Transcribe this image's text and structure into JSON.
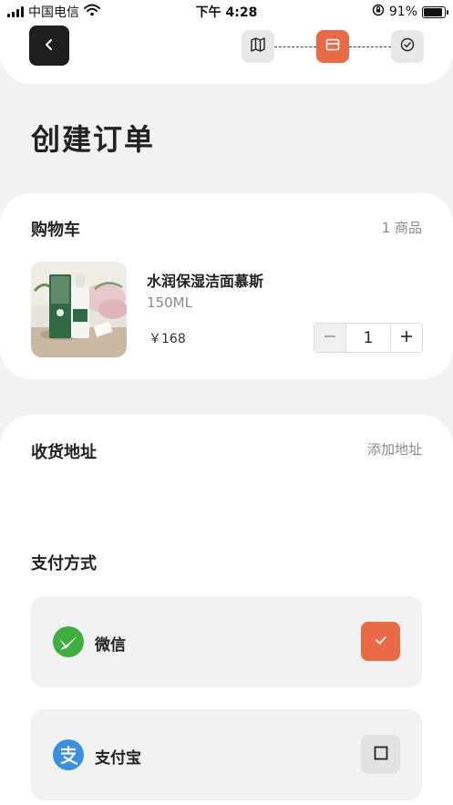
{
  "status_bar": {
    "carrier": "中国电信",
    "time": "下午 4:28",
    "battery": "91%",
    "battery_level": 0.91
  },
  "header": {
    "back_icon": "chevron-left-icon",
    "steps": [
      {
        "icon": "map-icon",
        "state": "done"
      },
      {
        "icon": "card-icon",
        "state": "active"
      },
      {
        "icon": "check-circle-icon",
        "state": "pending"
      }
    ],
    "accent_color": "#e96a45"
  },
  "page": {
    "title": "创建订单"
  },
  "cart": {
    "title": "购物车",
    "count": "1 商品",
    "item": {
      "name": "水润保湿洁面慕斯",
      "spec": "150ML",
      "price": "￥168",
      "quantity": "1"
    }
  },
  "address": {
    "title": "收货地址",
    "action": "添加地址"
  },
  "payment": {
    "title": "支付方式",
    "options": [
      {
        "label": "微信",
        "icon": "wechat-icon",
        "selected": true,
        "color": "#3fae3f"
      },
      {
        "label": "支付宝",
        "icon": "alipay-icon",
        "selected": false,
        "color": "#3b8fdf"
      }
    ]
  }
}
